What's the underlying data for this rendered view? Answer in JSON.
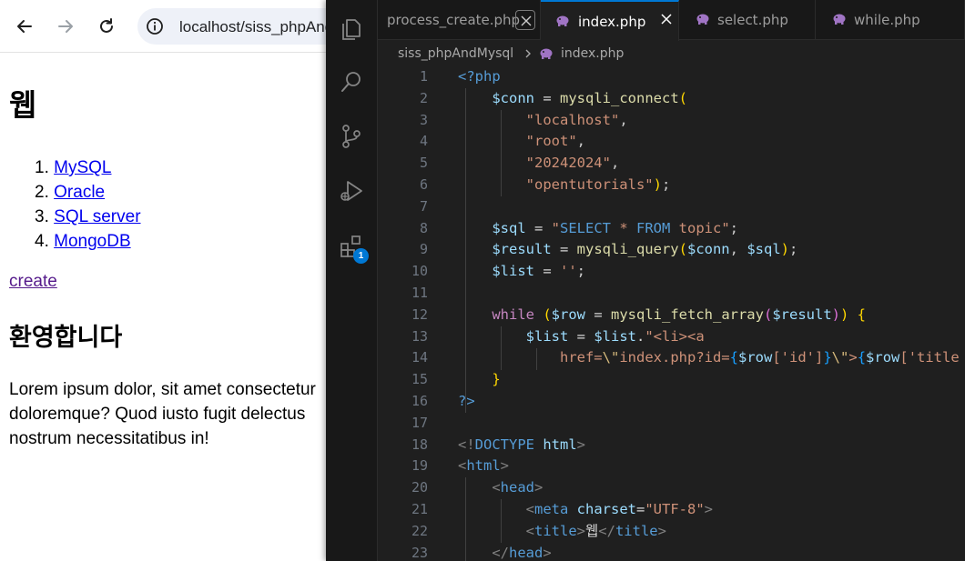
{
  "browser": {
    "url": "localhost/siss_phpAndMysql/index.php",
    "page": {
      "heading": "웹",
      "list": [
        {
          "num": "1.",
          "label": "MySQL"
        },
        {
          "num": "2.",
          "label": "Oracle"
        },
        {
          "num": "3.",
          "label": "SQL server"
        },
        {
          "num": "4.",
          "label": "MongoDB"
        }
      ],
      "create_link": "create",
      "welcome": "환영합니다",
      "lorem_lines": [
        "Lorem ipsum dolor, sit amet consectetur",
        "doloremque? Quod iusto fugit delectus",
        "nostrum necessitatibus in!"
      ]
    }
  },
  "vscode": {
    "tabs": [
      {
        "label": "process_create.php",
        "active": false
      },
      {
        "label": "index.php",
        "active": true
      },
      {
        "label": "select.php",
        "active": false
      },
      {
        "label": "while.php",
        "active": false
      }
    ],
    "breadcrumb": {
      "folder": "siss_phpAndMysql",
      "file": "index.php"
    },
    "extensions_badge": "1",
    "line_numbers": [
      "1",
      "2",
      "3",
      "4",
      "5",
      "6",
      "7",
      "8",
      "9",
      "10",
      "11",
      "12",
      "13",
      "14",
      "15",
      "16",
      "17",
      "18",
      "19",
      "20",
      "21",
      "22",
      "23"
    ],
    "code": {
      "l1": [
        "<?php"
      ],
      "l2": [
        "$conn",
        " = ",
        "mysqli_connect",
        "("
      ],
      "l3": [
        "\"localhost\"",
        ","
      ],
      "l4": [
        "\"root\"",
        ","
      ],
      "l5": [
        "\"20242024\"",
        ","
      ],
      "l6": [
        "\"opentutorials\"",
        ")",
        ";"
      ],
      "l8": [
        "$sql",
        " = ",
        "\"",
        "SELECT",
        " * ",
        "FROM",
        " topic",
        "\"",
        ";"
      ],
      "l9": [
        "$result",
        " = ",
        "mysqli_query",
        "(",
        "$conn",
        ", ",
        "$sql",
        ")",
        ";"
      ],
      "l10": [
        "$list",
        " = ",
        "''",
        ";"
      ],
      "l12": [
        "while",
        " (",
        "$row",
        " = ",
        "mysqli_fetch_array",
        "(",
        "$result",
        ")",
        ")",
        " {"
      ],
      "l13": [
        "$list",
        " = ",
        "$list",
        ".",
        "\"<li><a"
      ],
      "l14": [
        "href=",
        "\\\"",
        "index.php?id=",
        "{",
        "$row",
        "['id']",
        "}",
        "\\\"",
        ">",
        "{",
        "$row",
        "['title"
      ],
      "l15": [
        "}"
      ],
      "l16": [
        "?>"
      ],
      "l18": [
        "<!",
        "DOCTYPE",
        " html",
        ">"
      ],
      "l19": [
        "<",
        "html",
        ">"
      ],
      "l20": [
        "<",
        "head",
        ">"
      ],
      "l21": [
        "<",
        "meta",
        " charset",
        "=",
        "\"UTF-8\"",
        ">"
      ],
      "l22": [
        "<",
        "title",
        ">",
        "웹",
        "</",
        "title",
        ">"
      ],
      "l23": [
        "</",
        "head",
        ">"
      ]
    }
  }
}
